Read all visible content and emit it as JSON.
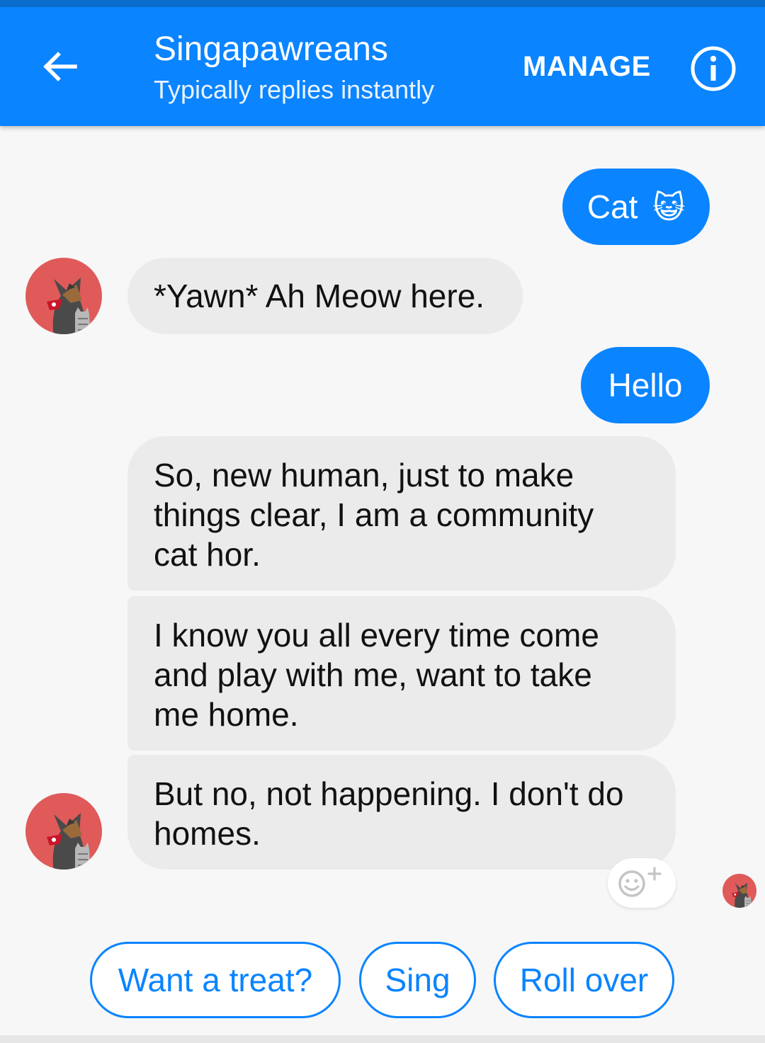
{
  "header": {
    "title": "Singapawreans",
    "subtitle": "Typically replies instantly",
    "manage_label": "MANAGE",
    "back_icon": "arrow-back-icon",
    "info_icon": "info-icon",
    "bar_color": "#0a84ff"
  },
  "messages": [
    {
      "from": "user",
      "text": "Cat",
      "emoji": "😺"
    },
    {
      "from": "bot",
      "text": "*Yawn* Ah Meow here."
    },
    {
      "from": "user",
      "text": "Hello"
    },
    {
      "from": "bot",
      "lines": [
        "So, new human, just to make",
        "things clear, I am a community",
        "cat hor."
      ]
    },
    {
      "from": "bot",
      "lines": [
        "I know you all every time come",
        "and play with me, want to take",
        "me home."
      ]
    },
    {
      "from": "bot",
      "lines": [
        "But no, not happening. I don't do",
        "homes."
      ]
    }
  ],
  "reaction_icon": "add-reaction-icon",
  "quick_replies": [
    "Want a treat?",
    "Sing",
    "Roll over"
  ],
  "colors": {
    "accent": "#0a84ff",
    "incoming_bubble": "#ebebeb",
    "avatar_bg": "#e05a5a"
  }
}
